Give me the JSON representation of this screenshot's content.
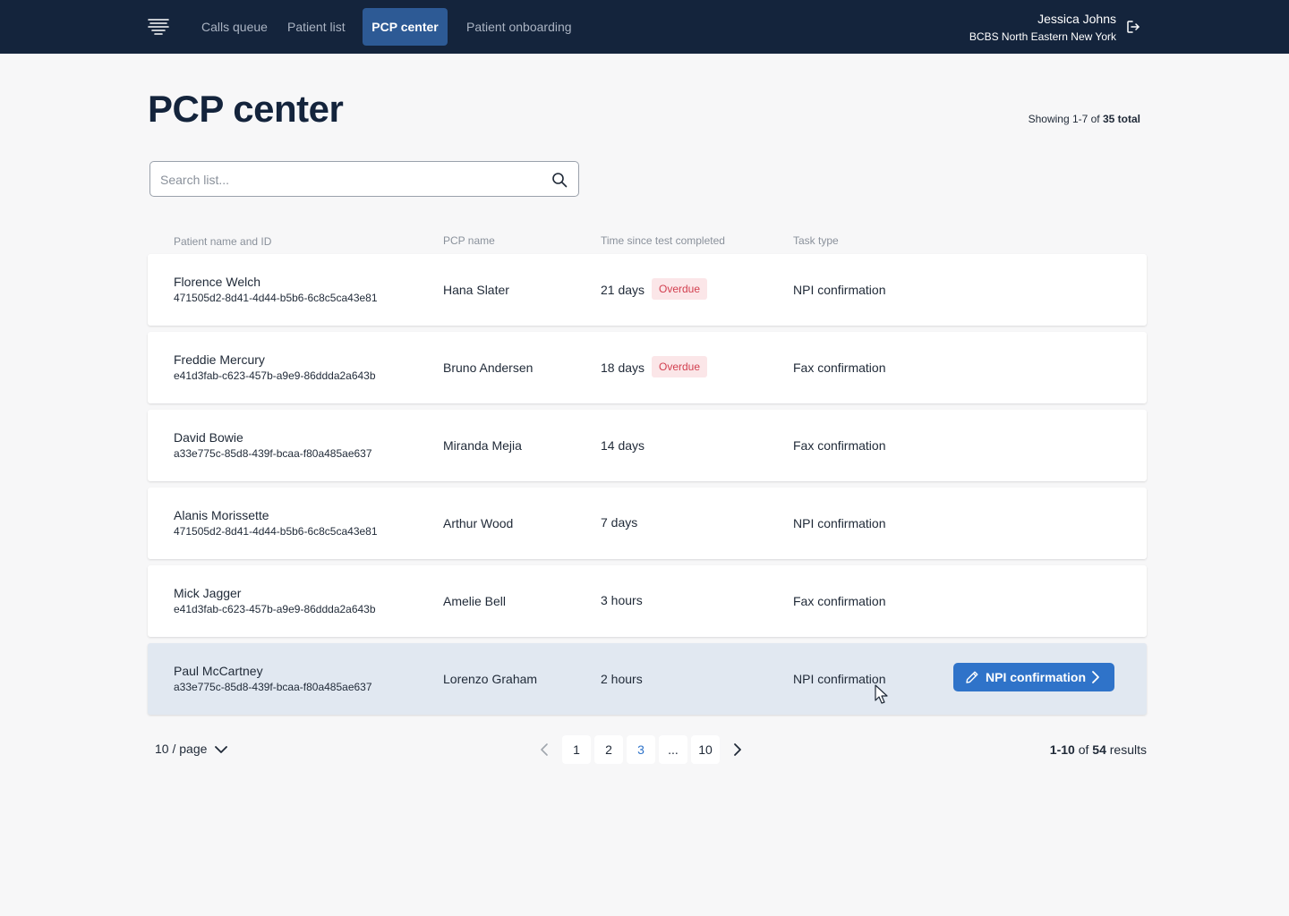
{
  "nav": {
    "items": [
      {
        "label": "Calls queue",
        "active": false
      },
      {
        "label": "Patient list",
        "active": false
      },
      {
        "label": "PCP center",
        "active": true
      },
      {
        "label": "Patient onboarding",
        "active": false
      }
    ],
    "user_name": "Jessica Johns",
    "user_org": "BCBS North Eastern New York",
    "logo_icon": "dna-logo-icon",
    "logout_icon": "logout-icon"
  },
  "page": {
    "title": "PCP center",
    "showing_prefix": "Showing 1-7 of ",
    "showing_total": "35 total"
  },
  "search": {
    "placeholder": "Search list...",
    "value": ""
  },
  "table": {
    "headers": [
      "Patient name and ID",
      "PCP name",
      "Time since test completed",
      "Task type"
    ],
    "rows": [
      {
        "name": "Florence Welch",
        "id": "471505d2-8d41-4d44-b5b6-6c8c5ca43e81",
        "pcp": "Hana Slater",
        "time": "21 days",
        "badge": "Overdue",
        "task": "NPI confirmation"
      },
      {
        "name": "Freddie Mercury",
        "id": "e41d3fab-c623-457b-a9e9-86ddda2a643b",
        "pcp": "Bruno Andersen",
        "time": "18 days",
        "badge": "Overdue",
        "task": "Fax confirmation"
      },
      {
        "name": "David Bowie",
        "id": "a33e775c-85d8-439f-bcaa-f80a485ae637",
        "pcp": "Miranda Mejia",
        "time": "14 days",
        "badge": "",
        "task": "Fax confirmation"
      },
      {
        "name": "Alanis Morissette",
        "id": "471505d2-8d41-4d44-b5b6-6c8c5ca43e81",
        "pcp": "Arthur Wood",
        "time": "7 days",
        "badge": "",
        "task": "NPI confirmation"
      },
      {
        "name": "Mick Jagger",
        "id": "e41d3fab-c623-457b-a9e9-86ddda2a643b",
        "pcp": "Amelie Bell",
        "time": "3 hours",
        "badge": "",
        "task": "Fax confirmation"
      },
      {
        "name": "Paul McCartney",
        "id": "a33e775c-85d8-439f-bcaa-f80a485ae637",
        "pcp": "Lorenzo Graham",
        "time": "2 hours",
        "badge": "",
        "task": "NPI confirmation",
        "action": "NPI confirmation"
      }
    ]
  },
  "pagination": {
    "per_page": "10 / page",
    "pages": [
      "1",
      "2",
      "3",
      "...",
      "10"
    ],
    "current": "3",
    "results_range": "1-10",
    "results_of": " of ",
    "results_total": "54",
    "results_suffix": " results"
  },
  "colors": {
    "nav_bg": "#14243c",
    "accent": "#2f73c9",
    "overdue_text": "#d23f4f",
    "overdue_bg": "#fbe6e8",
    "hover_row": "#e1e8f1"
  }
}
